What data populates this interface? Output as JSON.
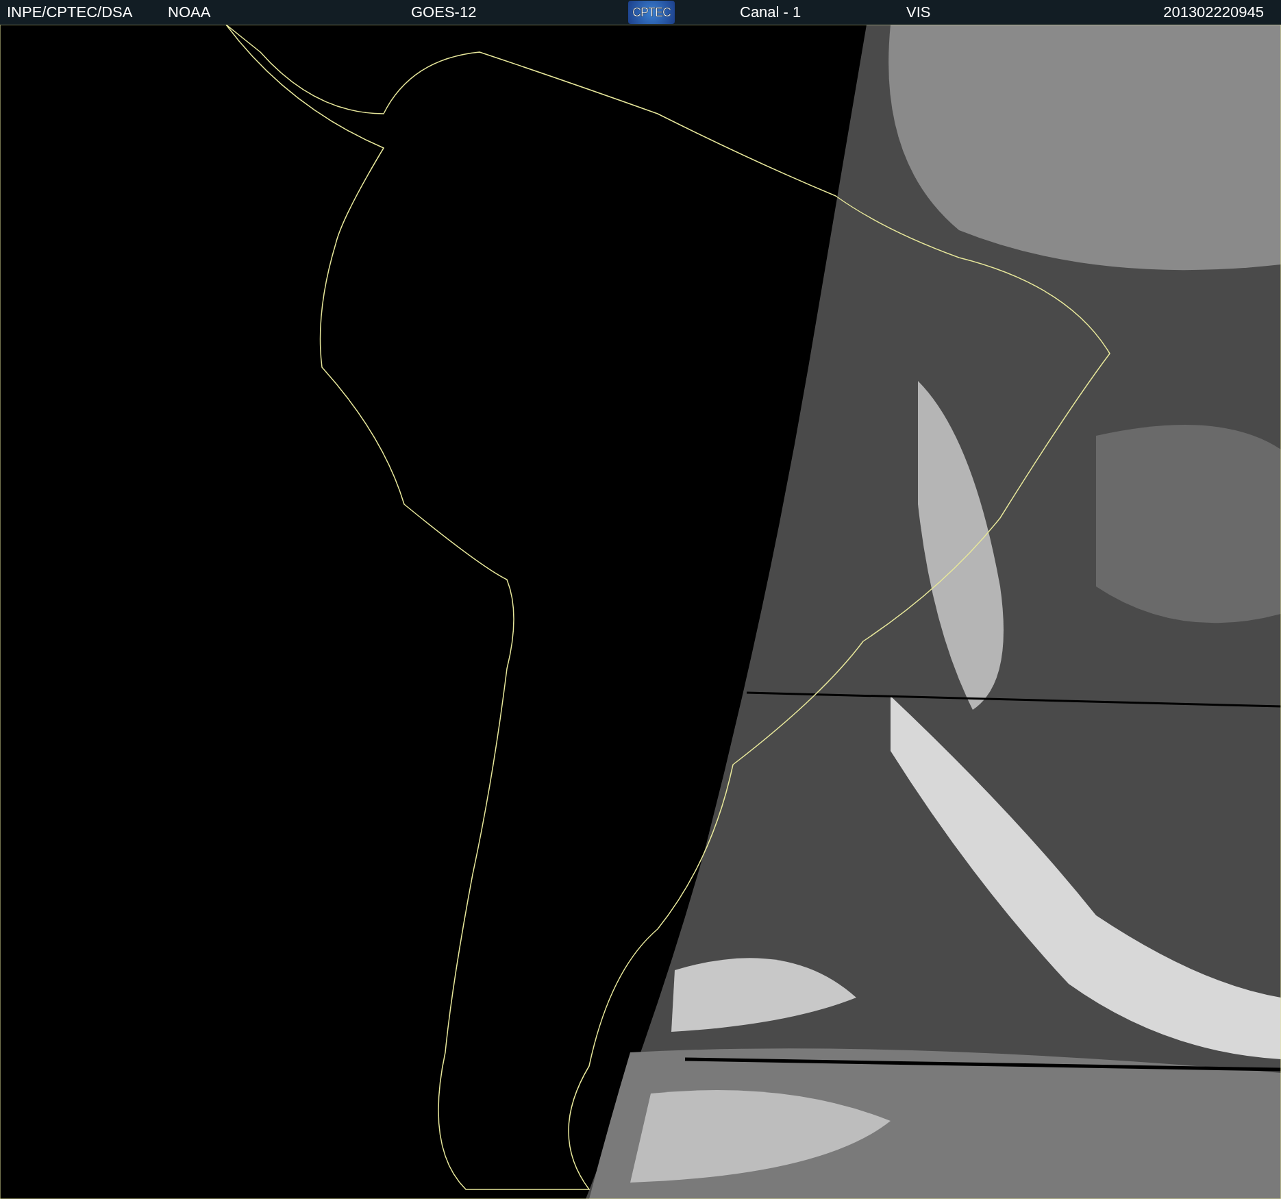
{
  "header": {
    "source": "INPE/CPTEC/DSA",
    "agency": "NOAA",
    "satellite": "GOES-12",
    "logo": "CPTEC",
    "channel": "Canal - 1",
    "band": "VIS",
    "timestamp": "201302220945"
  }
}
